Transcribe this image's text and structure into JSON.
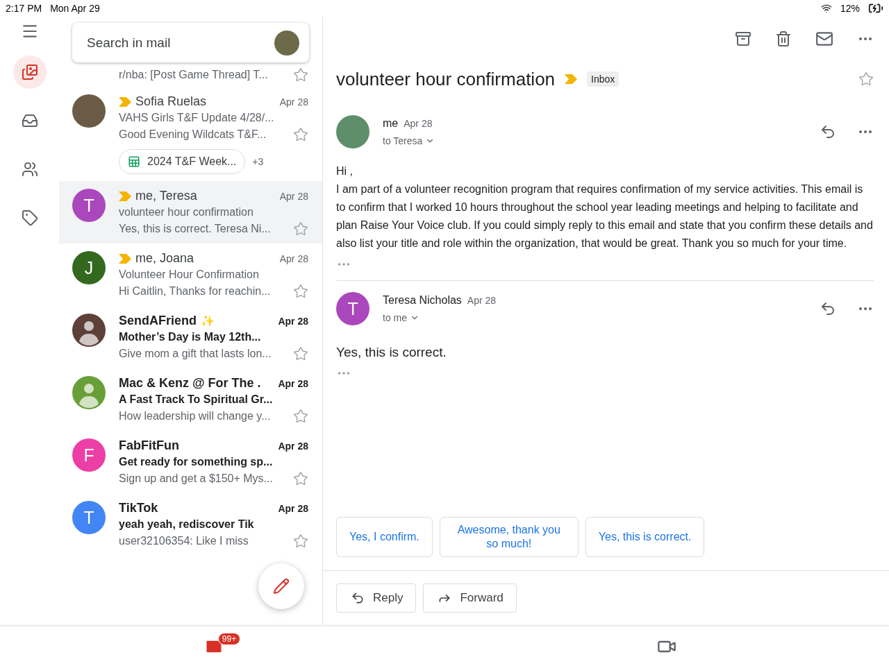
{
  "status_bar": {
    "time": "2:17 PM",
    "date": "Mon Apr 29",
    "battery": "12%"
  },
  "rail": {
    "items": [
      {
        "kind": "all-inboxes",
        "selected": true
      },
      {
        "kind": "inbox",
        "selected": false
      },
      {
        "kind": "people",
        "selected": false
      },
      {
        "kind": "tag",
        "selected": false
      }
    ]
  },
  "search": {
    "placeholder": "Search in mail"
  },
  "partial_row": {
    "snippet": "r/nba: [Post Game Thread] T..."
  },
  "emails": [
    {
      "kind": "photo",
      "color": "#6b5a45",
      "important": true,
      "sender": "Sofia Ruelas",
      "date": "Apr 28",
      "subject": "VAHS Girls T&F Update 4/28/...",
      "snippet": "Good Evening Wildcats T&F...",
      "unread": false,
      "selected": false,
      "starred": false,
      "attachment": {
        "name": "2024 T&F Week...",
        "more": "+3"
      }
    },
    {
      "kind": "letter",
      "initial": "T",
      "color": "#ab47bc",
      "important": true,
      "sender": "me, Teresa",
      "date": "Apr 28",
      "subject": "volunteer hour confirmation",
      "snippet": "Yes, this is correct. Teresa Ni...",
      "unread": false,
      "selected": true,
      "starred": false
    },
    {
      "kind": "letter",
      "initial": "J",
      "color": "#33691e",
      "important": true,
      "sender": "me, Joana",
      "date": "Apr 28",
      "subject": "Volunteer Hour Confirmation",
      "snippet": "Hi Caitlin, Thanks for reachin...",
      "unread": false,
      "selected": false,
      "starred": false
    },
    {
      "kind": "person",
      "color": "#5d4037",
      "important": false,
      "sender": "SendAFriend",
      "emoji": "✨",
      "date": "Apr 28",
      "subject": "Mother’s Day is May 12th...",
      "snippet": "Give mom a gift that lasts lon...",
      "unread": true,
      "selected": false,
      "starred": false
    },
    {
      "kind": "person",
      "color": "#689f38",
      "important": false,
      "sender": "Mac & Kenz @ For The .",
      "date": "Apr 28",
      "subject": "A Fast Track To Spiritual Gr...",
      "snippet": "How leadership will change y...",
      "unread": true,
      "selected": false,
      "starred": false
    },
    {
      "kind": "letter",
      "initial": "F",
      "color": "#ec3fa6",
      "important": false,
      "sender": "FabFitFun",
      "date": "Apr 28",
      "subject": "Get ready for something sp...",
      "snippet": "Sign up and get a $150+ Mys...",
      "unread": true,
      "selected": false,
      "starred": false
    },
    {
      "kind": "letter",
      "initial": "T",
      "color": "#4285f4",
      "important": false,
      "sender": "TikTok",
      "date": "Apr 28",
      "subject": "yeah yeah, rediscover Tik",
      "snippet": "user32106354: Like I miss",
      "unread": true,
      "selected": false,
      "starred": false
    }
  ],
  "detail": {
    "subject": "volunteer hour confirmation",
    "important": true,
    "label": "Inbox",
    "starred": false,
    "messages": [
      {
        "kind": "photo",
        "color": "#5f8f6a",
        "sender": "me",
        "date": "Apr 28",
        "to": "to Teresa",
        "greeting": "Hi ,",
        "body": "I am part of a volunteer recognition program that requires confirmation of my service activities. This email is to confirm that I worked 10 hours throughout the school year leading meetings and helping to facilitate and plan Raise Your Voice club. If you could simply reply to this email and state that you confirm these details and also list your title and role within the organization, that would be great. Thank you so much for your time."
      },
      {
        "kind": "letter",
        "initial": "T",
        "color": "#ab47bc",
        "sender": "Teresa Nicholas",
        "date": "Apr 28",
        "to": "to me",
        "body": "Yes, this is correct."
      }
    ],
    "smart_replies": [
      "Yes, I confirm.",
      "Awesome, thank you so much!",
      "Yes, this is correct."
    ],
    "actions": [
      {
        "kind": "reply",
        "label": "Reply"
      },
      {
        "kind": "forward",
        "label": "Forward"
      }
    ]
  },
  "bottom_nav": {
    "badge": "99+"
  }
}
